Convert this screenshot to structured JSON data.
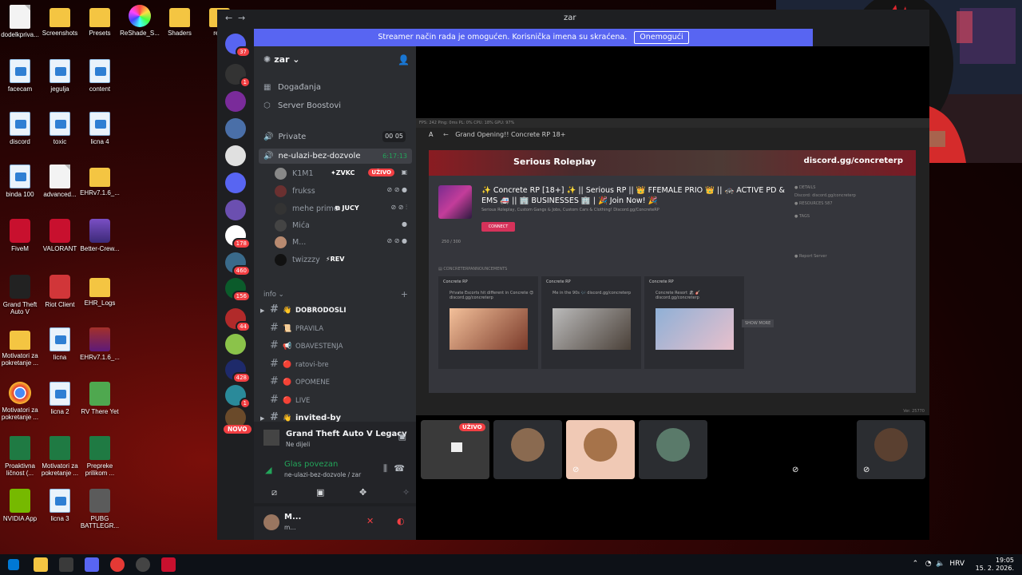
{
  "desktop": {
    "icons": [
      {
        "label": "dodelkpriva...",
        "kind": "doc"
      },
      {
        "label": "Screenshots",
        "kind": "folder"
      },
      {
        "label": "Presets",
        "kind": "folder"
      },
      {
        "label": "ReShade_S...",
        "kind": "app-rainbow"
      },
      {
        "label": "Shaders",
        "kind": "folder"
      },
      {
        "label": "resh",
        "kind": "folder"
      },
      {
        "label": "facecam",
        "kind": "img"
      },
      {
        "label": "jegulja",
        "kind": "img"
      },
      {
        "label": "content",
        "kind": "img"
      },
      {
        "label": "discord",
        "kind": "img"
      },
      {
        "label": "toxic",
        "kind": "img"
      },
      {
        "label": "licna 4",
        "kind": "img"
      },
      {
        "label": "binda 100",
        "kind": "img"
      },
      {
        "label": "advanced...",
        "kind": "doc"
      },
      {
        "label": "EHRv7.1.6_...",
        "kind": "folder"
      },
      {
        "label": "FiveM",
        "kind": "app-red"
      },
      {
        "label": "VALORANT",
        "kind": "app-red"
      },
      {
        "label": "Better-Crew...",
        "kind": "app-purple"
      },
      {
        "label": "Grand Theft Auto V",
        "kind": "app-gta"
      },
      {
        "label": "Riot Client",
        "kind": "app-riot"
      },
      {
        "label": "EHR_Logs",
        "kind": "folder"
      },
      {
        "label": "Motivatori za pokretanje ...",
        "kind": "folder"
      },
      {
        "label": "licna",
        "kind": "img"
      },
      {
        "label": "EHRv7.1.6_...",
        "kind": "app-rar"
      },
      {
        "label": "Motivatori za pokretanje ...",
        "kind": "app-chrome"
      },
      {
        "label": "licna 2",
        "kind": "img"
      },
      {
        "label": "RV There Yet",
        "kind": "app-rv"
      },
      {
        "label": "Proaktivna ličnost (...",
        "kind": "xls"
      },
      {
        "label": "Motivatori za pokretanje ...",
        "kind": "xls"
      },
      {
        "label": "Prepreke prilikom ...",
        "kind": "xls"
      },
      {
        "label": "NVIDIA App",
        "kind": "app-nvidia"
      },
      {
        "label": "licna 3",
        "kind": "img"
      },
      {
        "label": "PUBG BATTLEGR...",
        "kind": "app-pubg"
      }
    ]
  },
  "window": {
    "title": "zar",
    "nav_back": "←",
    "nav_forward": "→"
  },
  "banner": {
    "text": "Streamer način rada je omogućen. Korisnička imena su skraćena.",
    "button": "Onemogući"
  },
  "guilds": {
    "badges": [
      "37",
      "1",
      "178",
      "460",
      "156",
      "44",
      "428",
      "1"
    ],
    "new_label": "NOVO"
  },
  "server": {
    "name": "zar ⌄",
    "links": [
      {
        "label": "Događanja",
        "icon": "calendar-icon"
      },
      {
        "label": "Server Boostovi",
        "icon": "boost-icon"
      }
    ]
  },
  "voice_channels": [
    {
      "name": "Private",
      "extra": "00  05",
      "active": false
    },
    {
      "name": "ne-ulazi-bez-dozvole",
      "extra": "6:17:13",
      "active": true
    }
  ],
  "voice_users": [
    {
      "name": "K1M1",
      "tag": "✦ZVKC",
      "live": "UŽIVO",
      "icons": "▣"
    },
    {
      "name": "frukss",
      "tag": "",
      "live": "",
      "icons": "⊘ ⊘ ●"
    },
    {
      "name": "mehe prime",
      "tag": "⧉ JUCY",
      "live": "",
      "icons": "⊘ ⊘ ⫶"
    },
    {
      "name": "Mića",
      "tag": "",
      "live": "",
      "icons": "●"
    },
    {
      "name": "M...",
      "tag": "",
      "live": "",
      "icons": "⊘ ⊘ ●"
    },
    {
      "name": "twizzzy",
      "tag": "⚡REV",
      "live": "",
      "icons": ""
    }
  ],
  "category": {
    "name": "info ⌄",
    "add": "+"
  },
  "text_channels": [
    {
      "emoji": "👋",
      "name": "DOBRODOSLI",
      "bold": true,
      "arrow": "▶"
    },
    {
      "emoji": "📜",
      "name": "PRAVILA",
      "bold": false,
      "arrow": ""
    },
    {
      "emoji": "📢",
      "name": "OBAVESTENJA",
      "bold": false,
      "arrow": ""
    },
    {
      "emoji": "🔴",
      "name": "ratovi-bre",
      "bold": false,
      "arrow": ""
    },
    {
      "emoji": "🔴",
      "name": "OPOMENE",
      "bold": false,
      "arrow": ""
    },
    {
      "emoji": "🔴",
      "name": "LIVE",
      "bold": false,
      "arrow": ""
    },
    {
      "emoji": "👋",
      "name": "invited-by",
      "bold": true,
      "arrow": "▶"
    }
  ],
  "activity": {
    "game": "Grand Theft Auto V Legacy",
    "sub": "Ne dijeli"
  },
  "voice_status": {
    "title": "Glas povezan",
    "channel": "ne-ulazi-bez-dozvole / zar"
  },
  "user_panel": {
    "name": "M...",
    "status": "m..."
  },
  "stream": {
    "fivem_stats": "FPS: 242     Ping: 0ms     PL: 0%     CPU: 18%     GPU: 97%",
    "header": "Grand Opening!! Concrete RP 18+",
    "banner_left": "Serious Roleplay",
    "banner_right": "discord.gg/concreterp",
    "title": "✨ Concrete RP [18+] ✨ || Serious RP || 👑 FFEMALE PRIO 👑 || 🚓 ACTIVE PD & EMS 🚑 || 🏢 BUSINESSES 🏢 | 🎉 Join Now! 🎉",
    "subtitle": "Serious Roleplay, Custom Gangs & Jobs, Custom Cars & Clothing! Discord.gg/ConcreteRP",
    "connect": "CONNECT",
    "players": "250 / 300",
    "side_lines": [
      "● DETAILS",
      "Discord:   discord.gg/concreterp",
      "● RESOURCES   587",
      "● TAGS",
      "● Report Server"
    ],
    "feed_label": "▤ CONCRETERPANNOUNCEMENTS",
    "feed": [
      {
        "head": "Concrete RP",
        "text": "Private Escorts hit different in Concrete 😍  discord.gg/concreterp"
      },
      {
        "head": "Concrete RP",
        "text": "Me in the 90s 🎶  discord.gg/concreterp"
      },
      {
        "head": "Concrete RP",
        "text": "Concrete Resort 🏖 🎸  discord.gg/concreterp"
      }
    ],
    "show_more": "SHOW MORE",
    "version": "Ver. 25770"
  },
  "tiles": {
    "live_label": "UŽIVO"
  },
  "taskbar": {
    "lang": "HRV",
    "time": "19:05",
    "date": "15. 2. 2026."
  },
  "colors": {
    "discord_bg": "#1e1f22",
    "sidebar": "#2b2d31",
    "blurple": "#5865f2",
    "live_red": "#f23f43",
    "green": "#23a55a"
  }
}
